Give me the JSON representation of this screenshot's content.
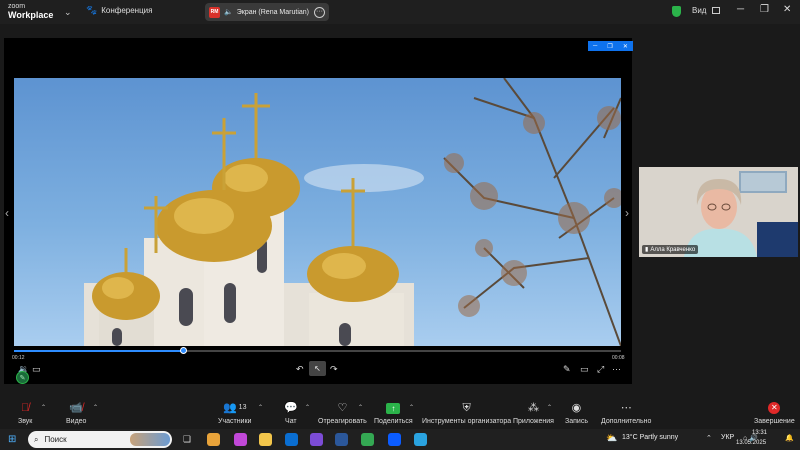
{
  "app": {
    "brand_line1": "zoom",
    "brand_line2": "Workplace"
  },
  "topbar": {
    "meeting_label": "Конференция",
    "share_badge": "RM",
    "share_label": "Экран (Rena Marutian)",
    "view_label": "Вид",
    "minimize": "─",
    "restore": "❐",
    "close": "✕"
  },
  "player": {
    "time_elapsed": "00:12",
    "time_total": "00:08",
    "progress": 0.28
  },
  "participant": {
    "name": "Алла Кравченко"
  },
  "toolbar": {
    "audio": "Звук",
    "video": "Видео",
    "participants": "Участники",
    "participants_count": "13",
    "chat": "Чат",
    "react": "Отреагировать",
    "share": "Поделиться",
    "host_tools": "Инструменты организатора",
    "apps": "Приложения",
    "record": "Запись",
    "more": "Дополнительно",
    "end": "Завершение"
  },
  "taskbar": {
    "search_placeholder": "Поиск",
    "weather": "13°C  Partly sunny",
    "lang": "УКР",
    "time": "13:31",
    "date": "13.05.2025"
  },
  "colors": {
    "accent": "#0e72ed",
    "security": "#2bb34a",
    "end": "#e02828",
    "share_green": "#2bb34a"
  }
}
